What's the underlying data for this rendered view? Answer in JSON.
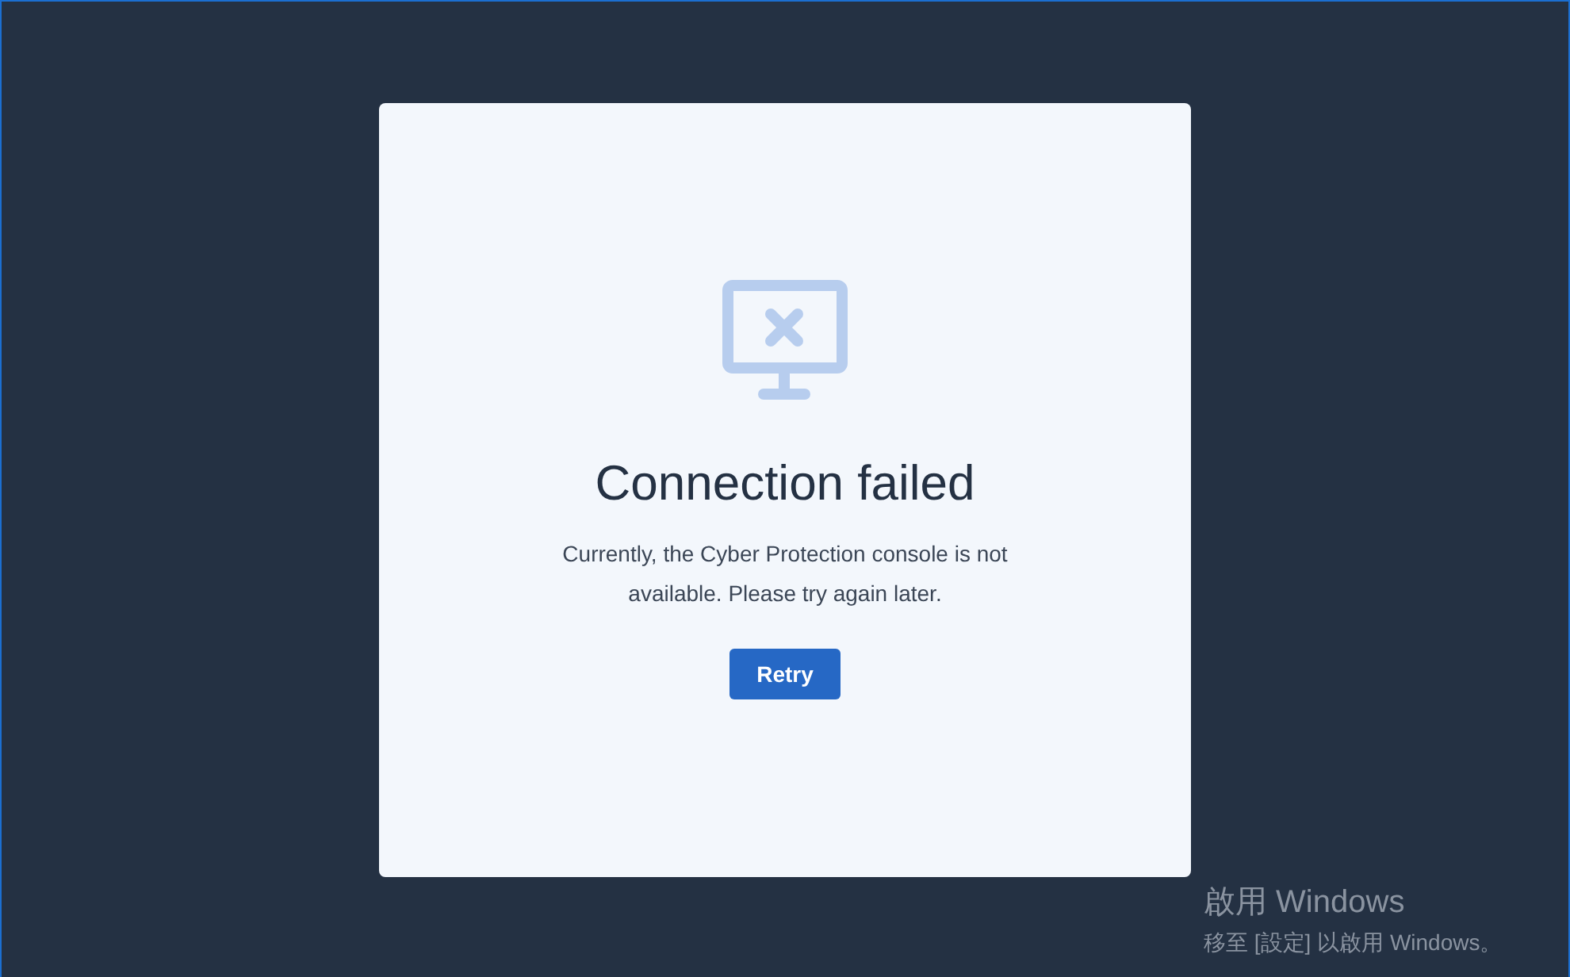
{
  "dialog": {
    "title": "Connection failed",
    "message": "Currently, the Cyber Protection console is not available. Please try again later.",
    "button": "Retry"
  },
  "activation_notice": {
    "title": "啟用 Windows",
    "message": "移至 [設定] 以啟用 Windows。"
  }
}
